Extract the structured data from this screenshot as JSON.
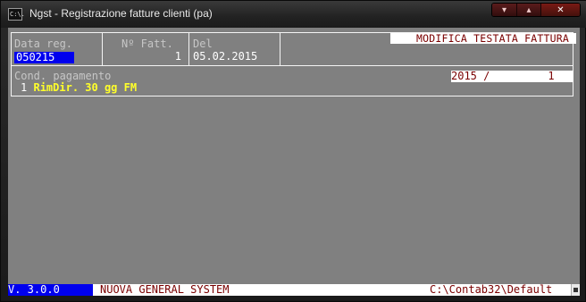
{
  "window": {
    "icon_text": "C:\\.",
    "title": "Ngst - Registrazione fatture clienti (pa)",
    "controls": {
      "minimize": "▾",
      "restore": "▴",
      "close": "✕"
    }
  },
  "form": {
    "banner": "MODIFICA TESTATA FATTURA",
    "data_reg_label": "Data reg.",
    "data_reg_value": "050215",
    "nfatt_label": "Nº Fatt.",
    "nfatt_value": "1",
    "del_label": "Del",
    "del_value": "05.02.2015",
    "cond_label": "Cond. pagamento",
    "cond_code": "1",
    "cond_desc": "RimDir. 30 gg FM",
    "year_box": "2015 /         1"
  },
  "statusbar": {
    "version": "V. 3.0.0",
    "system": "NUOVA GENERAL SYSTEM",
    "path": "C:\\Contab32\\Default"
  },
  "colors": {
    "console_bg": "#808080",
    "highlight_blue": "#0000ee",
    "banner_text": "#7a0000",
    "payment_text": "#ffff2a"
  }
}
